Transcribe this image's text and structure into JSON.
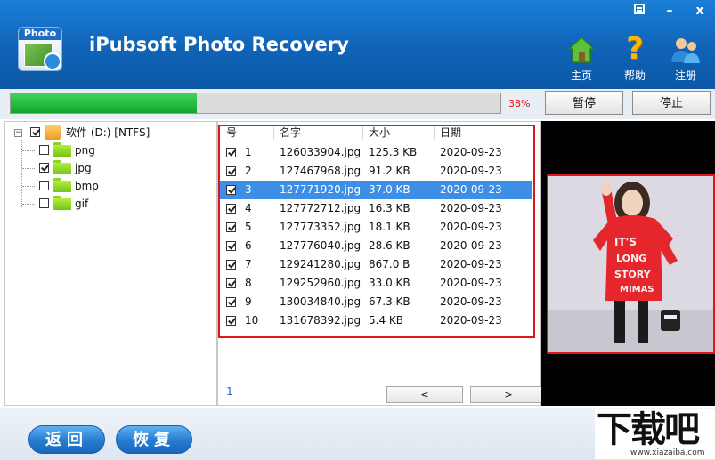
{
  "app": {
    "logo_text": "Photo",
    "title": "iPubsoft Photo Recovery"
  },
  "window_controls": {
    "minimize": "–",
    "close": "x"
  },
  "nav": {
    "home": "主页",
    "help": "帮助",
    "register": "注册"
  },
  "progress": {
    "percent_text": "38%",
    "value": 0.38,
    "pause": "暂停",
    "stop": "停止"
  },
  "tree": {
    "root": "软件 (D:) [NTFS]",
    "items": [
      {
        "label": "png",
        "checked": false
      },
      {
        "label": "jpg",
        "checked": true
      },
      {
        "label": "bmp",
        "checked": false
      },
      {
        "label": "gif",
        "checked": false
      }
    ]
  },
  "file_list": {
    "columns": {
      "no": "号",
      "name": "名字",
      "size": "大小",
      "date": "日期"
    },
    "rows": [
      {
        "no": "1",
        "name": "126033904.jpg",
        "size": "125.3 KB",
        "date": "2020-09-23"
      },
      {
        "no": "2",
        "name": "127467968.jpg",
        "size": "91.2 KB",
        "date": "2020-09-23"
      },
      {
        "no": "3",
        "name": "127771920.jpg",
        "size": "37.0 KB",
        "date": "2020-09-23"
      },
      {
        "no": "4",
        "name": "127772712.jpg",
        "size": "16.3 KB",
        "date": "2020-09-23"
      },
      {
        "no": "5",
        "name": "127773352.jpg",
        "size": "18.1 KB",
        "date": "2020-09-23"
      },
      {
        "no": "6",
        "name": "127776040.jpg",
        "size": "28.6 KB",
        "date": "2020-09-23"
      },
      {
        "no": "7",
        "name": "129241280.jpg",
        "size": "867.0 B",
        "date": "2020-09-23"
      },
      {
        "no": "8",
        "name": "129252960.jpg",
        "size": "33.0 KB",
        "date": "2020-09-23"
      },
      {
        "no": "9",
        "name": "130034840.jpg",
        "size": "67.3 KB",
        "date": "2020-09-23"
      },
      {
        "no": "10",
        "name": "131678392.jpg",
        "size": "5.4 KB",
        "date": "2020-09-23"
      }
    ],
    "selected_index": 2,
    "page": "1",
    "prev": "<",
    "next": ">"
  },
  "bottom": {
    "back": "返回",
    "recover": "恢复"
  },
  "watermark": {
    "main": "下载吧",
    "sub": "www.xiazaiba.com"
  },
  "colors": {
    "header": "#0f63b6",
    "progress_fill": "#10a52c",
    "selection": "#3d8ee6",
    "highlight_frame": "#e0161e"
  }
}
